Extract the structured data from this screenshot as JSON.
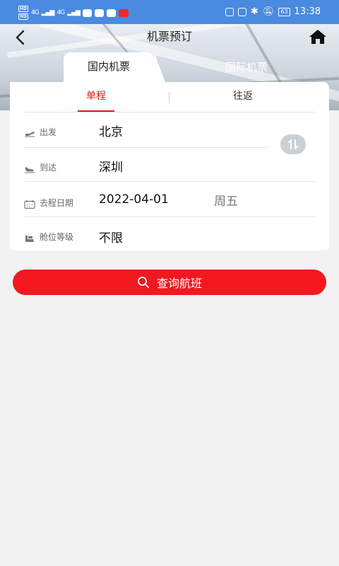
{
  "status_bar": {
    "hd_badges": [
      "HD",
      "HD"
    ],
    "network_1": "4G",
    "network_2": "4G",
    "battery": "63",
    "time": "13:38"
  },
  "header": {
    "title": "机票预订",
    "back_icon": "chevron-left-icon",
    "home_icon": "home-icon"
  },
  "tabs": {
    "domestic": "国内机票",
    "international": "国际机票",
    "active": "domestic"
  },
  "trip_type": {
    "one_way": "单程",
    "round_trip": "往返",
    "active": "one_way"
  },
  "form": {
    "departure": {
      "label": "出发",
      "value": "北京",
      "icon": "takeoff-icon"
    },
    "arrival": {
      "label": "到达",
      "value": "深圳",
      "icon": "landing-icon"
    },
    "date": {
      "label": "去程日期",
      "value": "2022-04-01",
      "weekday": "周五",
      "icon": "calendar-icon"
    },
    "cabin": {
      "label": "舱位等级",
      "value": "不限",
      "icon": "seat-icon"
    },
    "swap_icon": "swap-arrows-icon"
  },
  "search": {
    "label": "查询航班",
    "icon": "search-icon"
  },
  "colors": {
    "accent_red": "#f31720",
    "status_bar_blue": "#4a8ae0",
    "background": "#f2f2f2"
  }
}
